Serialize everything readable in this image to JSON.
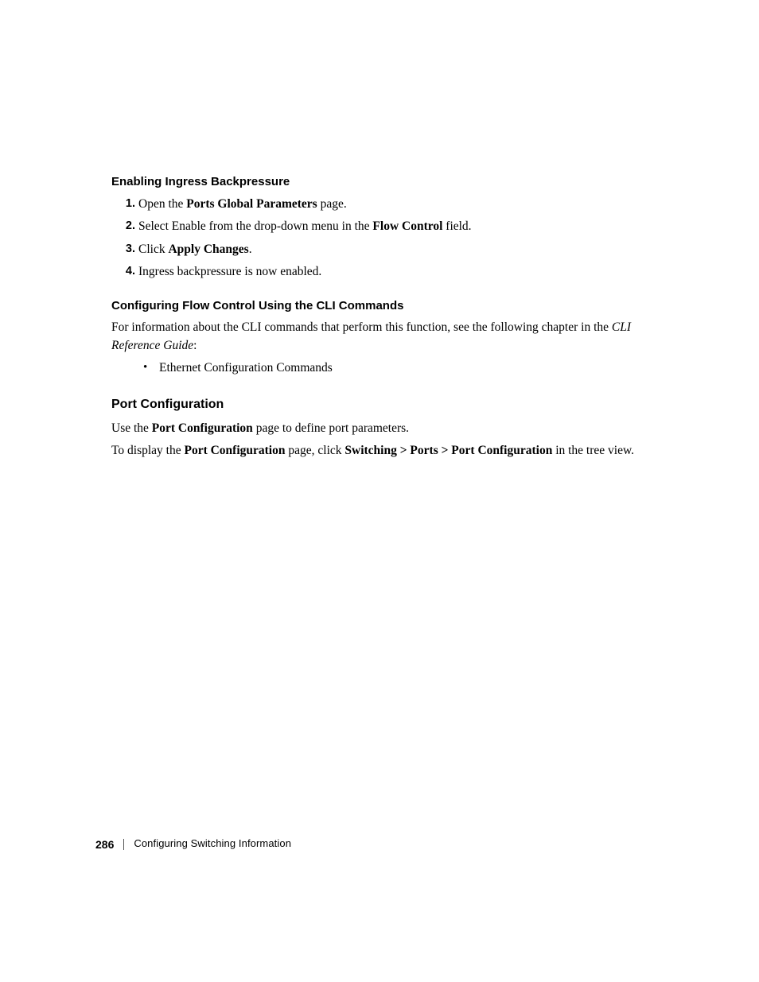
{
  "section1": {
    "heading": "Enabling Ingress Backpressure",
    "steps": [
      {
        "num": "1.",
        "pre": "Open the ",
        "bold": "Ports Global Parameters",
        "post": " page."
      },
      {
        "num": "2.",
        "pre": "Select Enable from the drop-down menu in the ",
        "bold": "Flow Control",
        "post": " field."
      },
      {
        "num": "3.",
        "pre": "Click ",
        "bold": "Apply Changes",
        "post": "."
      },
      {
        "num": "4.",
        "pre": "Ingress backpressure is now enabled.",
        "bold": "",
        "post": ""
      }
    ]
  },
  "section2": {
    "heading": "Configuring Flow Control Using the CLI Commands",
    "para_pre": "For information about the CLI commands that perform this function, see the following chapter in the ",
    "para_italic": "CLI Reference Guide",
    "para_post": ":",
    "bullets": [
      "Ethernet Configuration Commands"
    ]
  },
  "section3": {
    "heading": "Port Configuration",
    "para1_pre": "Use the ",
    "para1_bold": "Port Configuration",
    "para1_post": " page to define port parameters.",
    "para2_pre": "To display the ",
    "para2_bold1": "Port Configuration",
    "para2_mid": " page, click ",
    "para2_bold2": "Switching > Ports > Port Configuration",
    "para2_post": " in the tree view."
  },
  "footer": {
    "page": "286",
    "chapter": "Configuring Switching Information"
  }
}
